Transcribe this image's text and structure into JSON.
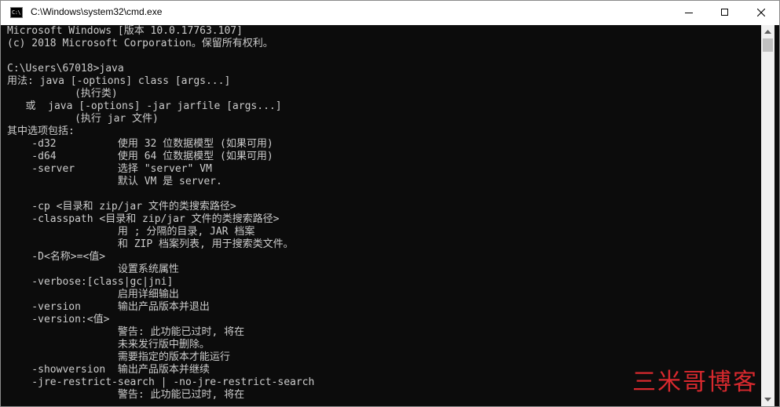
{
  "window": {
    "title": "C:\\Windows\\system32\\cmd.exe",
    "icon_text": "C:\\",
    "icon": "cmd-console-icon"
  },
  "controls": {
    "minimize_icon": "minimize-icon",
    "maximize_icon": "maximize-icon",
    "close_icon": "close-icon"
  },
  "console": {
    "background": "#0c0c0c",
    "foreground": "#cccccc",
    "lines": [
      "Microsoft Windows [版本 10.0.17763.107]",
      "(c) 2018 Microsoft Corporation。保留所有权利。",
      "",
      "C:\\Users\\67018>java",
      "用法: java [-options] class [args...]",
      "           (执行类)",
      "   或  java [-options] -jar jarfile [args...]",
      "           (执行 jar 文件)",
      "其中选项包括:",
      "    -d32          使用 32 位数据模型 (如果可用)",
      "    -d64          使用 64 位数据模型 (如果可用)",
      "    -server       选择 \"server\" VM",
      "                  默认 VM 是 server.",
      "",
      "    -cp <目录和 zip/jar 文件的类搜索路径>",
      "    -classpath <目录和 zip/jar 文件的类搜索路径>",
      "                  用 ; 分隔的目录, JAR 档案",
      "                  和 ZIP 档案列表, 用于搜索类文件。",
      "    -D<名称>=<值>",
      "                  设置系统属性",
      "    -verbose:[class|gc|jni]",
      "                  启用详细输出",
      "    -version      输出产品版本并退出",
      "    -version:<值>",
      "                  警告: 此功能已过时, 将在",
      "                  未来发行版中删除。",
      "                  需要指定的版本才能运行",
      "    -showversion  输出产品版本并继续",
      "    -jre-restrict-search | -no-jre-restrict-search",
      "                  警告: 此功能已过时, 将在"
    ]
  },
  "watermark": {
    "text": "三米哥博客",
    "color": "#d9292e"
  }
}
